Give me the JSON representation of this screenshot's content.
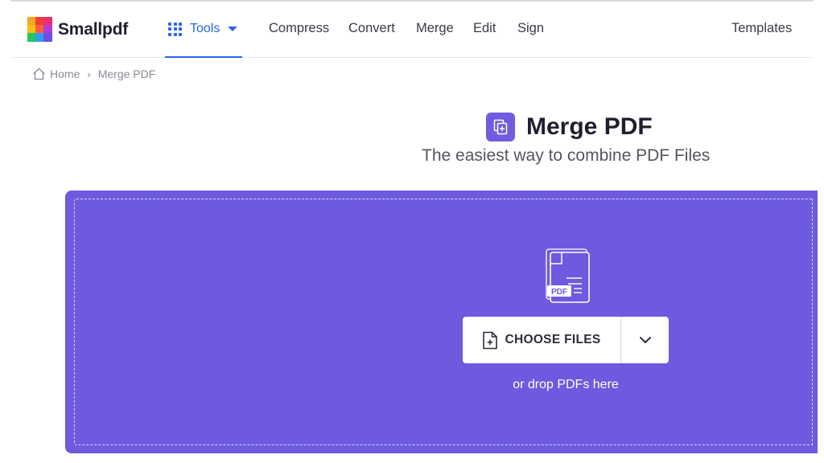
{
  "brand": {
    "name": "Smallpdf"
  },
  "nav": {
    "tools_label": "Tools",
    "links": [
      "Compress",
      "Convert",
      "Merge",
      "Edit",
      "Sign"
    ],
    "templates_label": "Templates"
  },
  "breadcrumb": {
    "home": "Home",
    "separator": "›",
    "current": "Merge PDF"
  },
  "page": {
    "title": "Merge PDF",
    "subtitle": "The easiest way to combine PDF Files"
  },
  "dropzone": {
    "pdf_badge": "PDF",
    "choose_label": "CHOOSE FILES",
    "drop_hint": "or drop PDFs here"
  },
  "colors": {
    "accent_blue": "#2b63e6",
    "merge_purple": "#6d5adf",
    "title_icon_purple": "#6f5ce0"
  },
  "icons": {
    "logo": "smallpdf-logo-icon",
    "tools": "grid-icon",
    "home": "home-icon",
    "title": "merge-icon",
    "file": "pdf-files-icon",
    "choose": "file-add-icon",
    "dropdown": "chevron-down-icon"
  }
}
